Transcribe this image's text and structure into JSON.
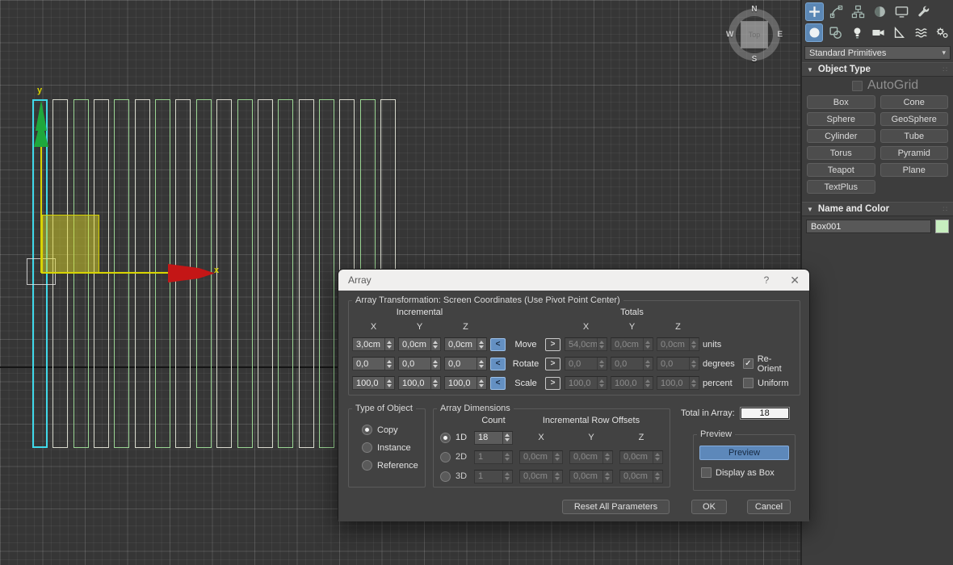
{
  "viewport": {
    "array_count": 18,
    "axis_x_label": "x",
    "axis_y_label": "y",
    "viewcube": {
      "n": "N",
      "e": "E",
      "s": "S",
      "w": "W",
      "face": "Top"
    },
    "colors": {
      "selected": "#3fd9e9",
      "copy_a": "#d8dacd",
      "copy_b": "#9bd694",
      "gizmo_x": "#c41616",
      "gizmo_y": "#1ea83c",
      "gizmo_line": "#d8d400"
    }
  },
  "panel": {
    "tabs": [
      {
        "name": "create",
        "active": true
      },
      {
        "name": "modify",
        "active": false
      },
      {
        "name": "hierarchy",
        "active": false
      },
      {
        "name": "motion",
        "active": false
      },
      {
        "name": "display",
        "active": false
      },
      {
        "name": "utilities",
        "active": false
      }
    ],
    "create_tabs": [
      {
        "name": "geometry",
        "active": true
      },
      {
        "name": "shapes",
        "active": false
      },
      {
        "name": "lights",
        "active": false
      },
      {
        "name": "cameras",
        "active": false
      },
      {
        "name": "helpers",
        "active": false
      },
      {
        "name": "space-warps",
        "active": false
      },
      {
        "name": "systems",
        "active": false
      }
    ],
    "category": "Standard Primitives",
    "object_type": {
      "title": "Object Type",
      "autogrid": "AutoGrid",
      "buttons": [
        "Box",
        "Cone",
        "Sphere",
        "GeoSphere",
        "Cylinder",
        "Tube",
        "Torus",
        "Pyramid",
        "Teapot",
        "Plane",
        "TextPlus"
      ]
    },
    "name_color": {
      "title": "Name and Color",
      "name": "Box001",
      "swatch": "#c7eebf"
    }
  },
  "dialog": {
    "title": "Array",
    "help_glyph": "?",
    "close_glyph": "✕",
    "transform": {
      "title": "Array Transformation: Screen Coordinates (Use Pivot Point Center)",
      "incremental": "Incremental",
      "totals": "Totals",
      "cols": [
        "X",
        "Y",
        "Z"
      ],
      "rows": [
        {
          "label": "Move",
          "inc": [
            "3,0cm",
            "0,0cm",
            "0,0cm"
          ],
          "tot": [
            "54,0cm",
            "0,0cm",
            "0,0cm"
          ],
          "unit": "units",
          "check": null
        },
        {
          "label": "Rotate",
          "inc": [
            "0,0",
            "0,0",
            "0,0"
          ],
          "tot": [
            "0,0",
            "0,0",
            "0,0"
          ],
          "unit": "degrees",
          "check": {
            "label": "Re-Orient",
            "checked": true
          }
        },
        {
          "label": "Scale",
          "inc": [
            "100,0",
            "100,0",
            "100,0"
          ],
          "tot": [
            "100,0",
            "100,0",
            "100,0"
          ],
          "unit": "percent",
          "check": {
            "label": "Uniform",
            "checked": false
          }
        }
      ]
    },
    "type_of_object": {
      "title": "Type of Object",
      "options": [
        "Copy",
        "Instance",
        "Reference"
      ],
      "selected": 0
    },
    "dimensions": {
      "title": "Array Dimensions",
      "count_label": "Count",
      "offsets_label": "Incremental Row Offsets",
      "cols": [
        "X",
        "Y",
        "Z"
      ],
      "rows": [
        {
          "label": "1D",
          "count": "18",
          "selected": true,
          "enabled": true,
          "offsets": null
        },
        {
          "label": "2D",
          "count": "1",
          "selected": false,
          "enabled": false,
          "offsets": [
            "0,0cm",
            "0,0cm",
            "0,0cm"
          ]
        },
        {
          "label": "3D",
          "count": "1",
          "selected": false,
          "enabled": false,
          "offsets": [
            "0,0cm",
            "0,0cm",
            "0,0cm"
          ]
        }
      ]
    },
    "total": {
      "label": "Total in Array:",
      "value": "18"
    },
    "preview": {
      "title": "Preview",
      "button": "Preview",
      "display_as_box": "Display as Box",
      "checked": false
    },
    "actions": {
      "reset": "Reset All Parameters",
      "ok": "OK",
      "cancel": "Cancel"
    }
  }
}
